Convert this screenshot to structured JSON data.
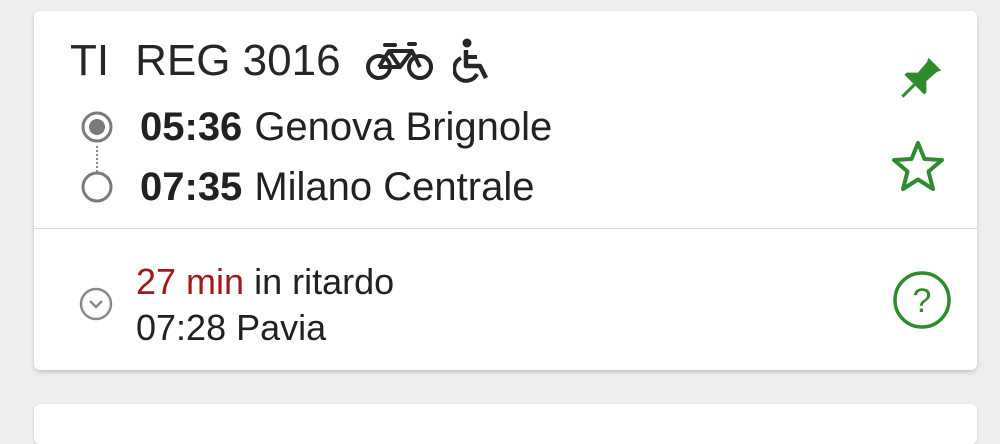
{
  "train": {
    "category": "TI",
    "number": "REG 3016",
    "service_icons": [
      "bicycle-icon",
      "wheelchair-icon"
    ]
  },
  "stops": {
    "departure": {
      "time": "05:36",
      "station": "Genova Brignole",
      "marker": "filled-radio-icon"
    },
    "arrival": {
      "time": "07:35",
      "station": "Milano Centrale",
      "marker": "empty-radio-icon"
    }
  },
  "status": {
    "icon": "clock-icon",
    "delay": "27 min",
    "delay_suffix": "in ritardo",
    "last_seen_time": "07:28",
    "last_seen_station": "Pavia"
  },
  "actions": {
    "pin_icon": "pin-icon",
    "favorite_icon": "star-outline-icon",
    "help_icon": "help-circle-icon"
  },
  "colors": {
    "accent_green": "#2e8b2e",
    "delay_red": "#a31919"
  }
}
